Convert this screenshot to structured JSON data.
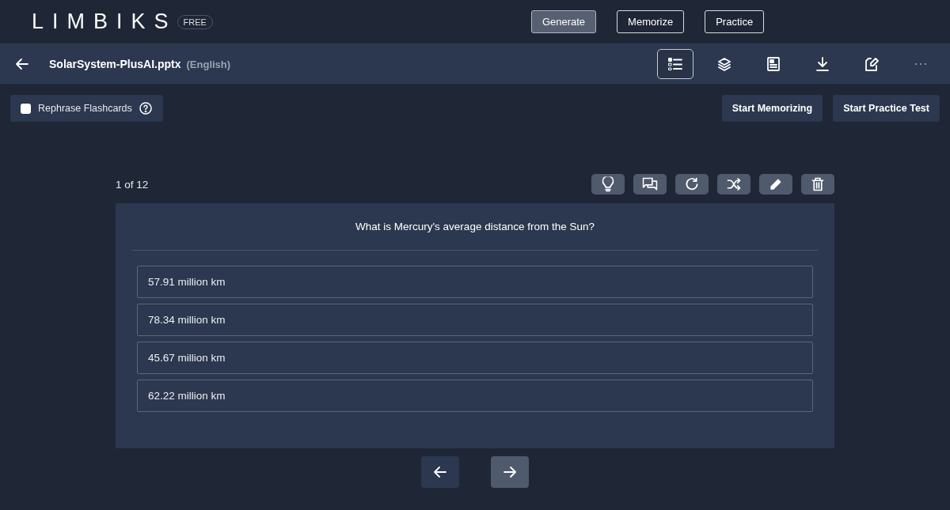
{
  "header": {
    "logo": "LIMBIKS",
    "plan_badge": "FREE",
    "nav": [
      {
        "label": "Generate",
        "selected": true
      },
      {
        "label": "Memorize",
        "selected": false
      },
      {
        "label": "Practice",
        "selected": false
      }
    ]
  },
  "file_bar": {
    "file_name": "SolarSystem-PlusAI.pptx",
    "language": "(English)",
    "tools": [
      {
        "kind": "list",
        "selected": true
      },
      {
        "kind": "layers",
        "selected": false
      },
      {
        "kind": "document",
        "selected": false
      },
      {
        "kind": "download",
        "selected": false
      },
      {
        "kind": "edit",
        "selected": false
      },
      {
        "kind": "more",
        "selected": false
      }
    ]
  },
  "options_bar": {
    "rephrase": {
      "label": "Rephrase Flashcards",
      "checked": false
    },
    "buttons": [
      "Start Memorizing",
      "Start Practice Test"
    ]
  },
  "card": {
    "counter": "1 of 12",
    "actions": [
      {
        "kind": "hint"
      },
      {
        "kind": "comments"
      },
      {
        "kind": "flip"
      },
      {
        "kind": "shuffle"
      },
      {
        "kind": "pencil"
      },
      {
        "kind": "trash"
      }
    ],
    "question": "What is Mercury's average distance from the Sun?",
    "options": [
      "57.91 million km",
      "78.34 million km",
      "45.67 million km",
      "62.22 million km"
    ]
  },
  "pager": [
    {
      "kind": "previous",
      "disabled": true
    },
    {
      "kind": "next",
      "disabled": false
    }
  ]
}
